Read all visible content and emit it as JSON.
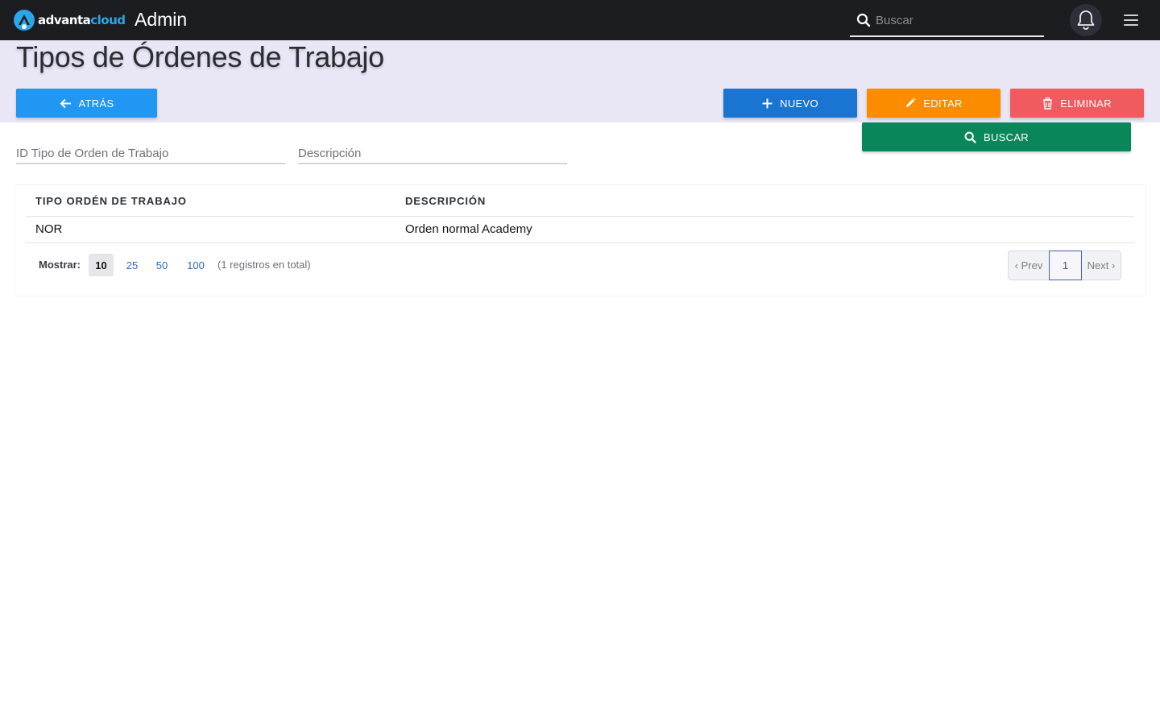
{
  "navbar": {
    "logo_part1": "advanta",
    "logo_part2": "cloud",
    "app_name": "Admin",
    "search_placeholder": "Buscar",
    "icons": {
      "search": "search-icon",
      "bell": "bell-icon",
      "menu": "hamburger-menu-icon"
    }
  },
  "header": {
    "title": "Tipos de Órdenes de Trabajo",
    "buttons": {
      "back": "ATRÁS",
      "new": "NUEVO",
      "edit": "EDITAR",
      "delete": "ELIMINAR",
      "search": "BUSCAR"
    }
  },
  "filters": {
    "id_placeholder": "ID Tipo de Orden de Trabajo",
    "desc_placeholder": "Descripción"
  },
  "table": {
    "columns": [
      "TIPO ORDÉN DE TRABAJO",
      "DESCRIPCIÓN"
    ],
    "rows": [
      [
        "NOR",
        "Orden normal Academy"
      ]
    ]
  },
  "pagination": {
    "show_label": "Mostrar:",
    "page_sizes": [
      "10",
      "25",
      "50",
      "100"
    ],
    "selected_page_size": "10",
    "total_text": "(1 registros en total)",
    "prev": "‹ Prev",
    "current_page": "1",
    "next": "Next ›"
  },
  "colors": {
    "navbar": "#1c1d20",
    "header_band": "#e9e6f6",
    "back": "#2196f3",
    "new": "#1a75d2",
    "edit": "#fb8c00",
    "delete": "#f15a5e",
    "search": "#09865a"
  }
}
